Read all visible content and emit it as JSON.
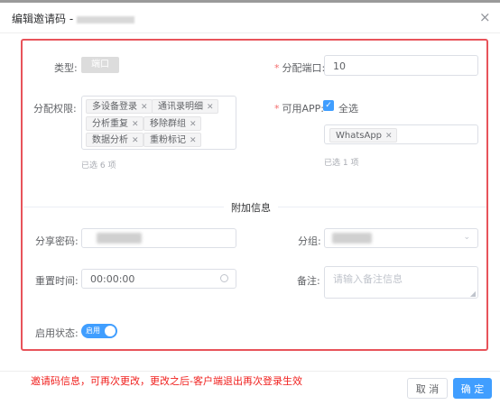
{
  "dialog": {
    "title": "编辑邀请码 -",
    "close": "×"
  },
  "form": {
    "type_label": "类型:",
    "type_value": "端口",
    "ports_label": "分配端口:",
    "ports_value": "10",
    "perm_label": "分配权限:",
    "perm_tags": [
      "多设备登录",
      "通讯录明细",
      "分析重复",
      "移除群组",
      "数据分析",
      "重粉标记"
    ],
    "perm_hint": "已选 6 项",
    "apps_label": "可用APP:",
    "select_all": "全选",
    "app_tags": [
      "WhatsApp"
    ],
    "apps_hint": "已选 1 项"
  },
  "extra": {
    "section_title": "附加信息",
    "share_pwd_label": "分享密码:",
    "group_label": "分组:",
    "reset_time_label": "重置时间:",
    "reset_time_value": "00:00:00",
    "remark_label": "备注:",
    "remark_placeholder": "请输入备注信息",
    "enable_label": "启用状态:",
    "enable_switch_text": "启用"
  },
  "note": "邀请码信息，可再次更改，更改之后-客户端退出再次登录生效",
  "buttons": {
    "cancel": "取 消",
    "ok": "确 定"
  },
  "colors": {
    "primary": "#409eff",
    "annotation_red": "#e8535a",
    "note_red": "#f0201e"
  }
}
